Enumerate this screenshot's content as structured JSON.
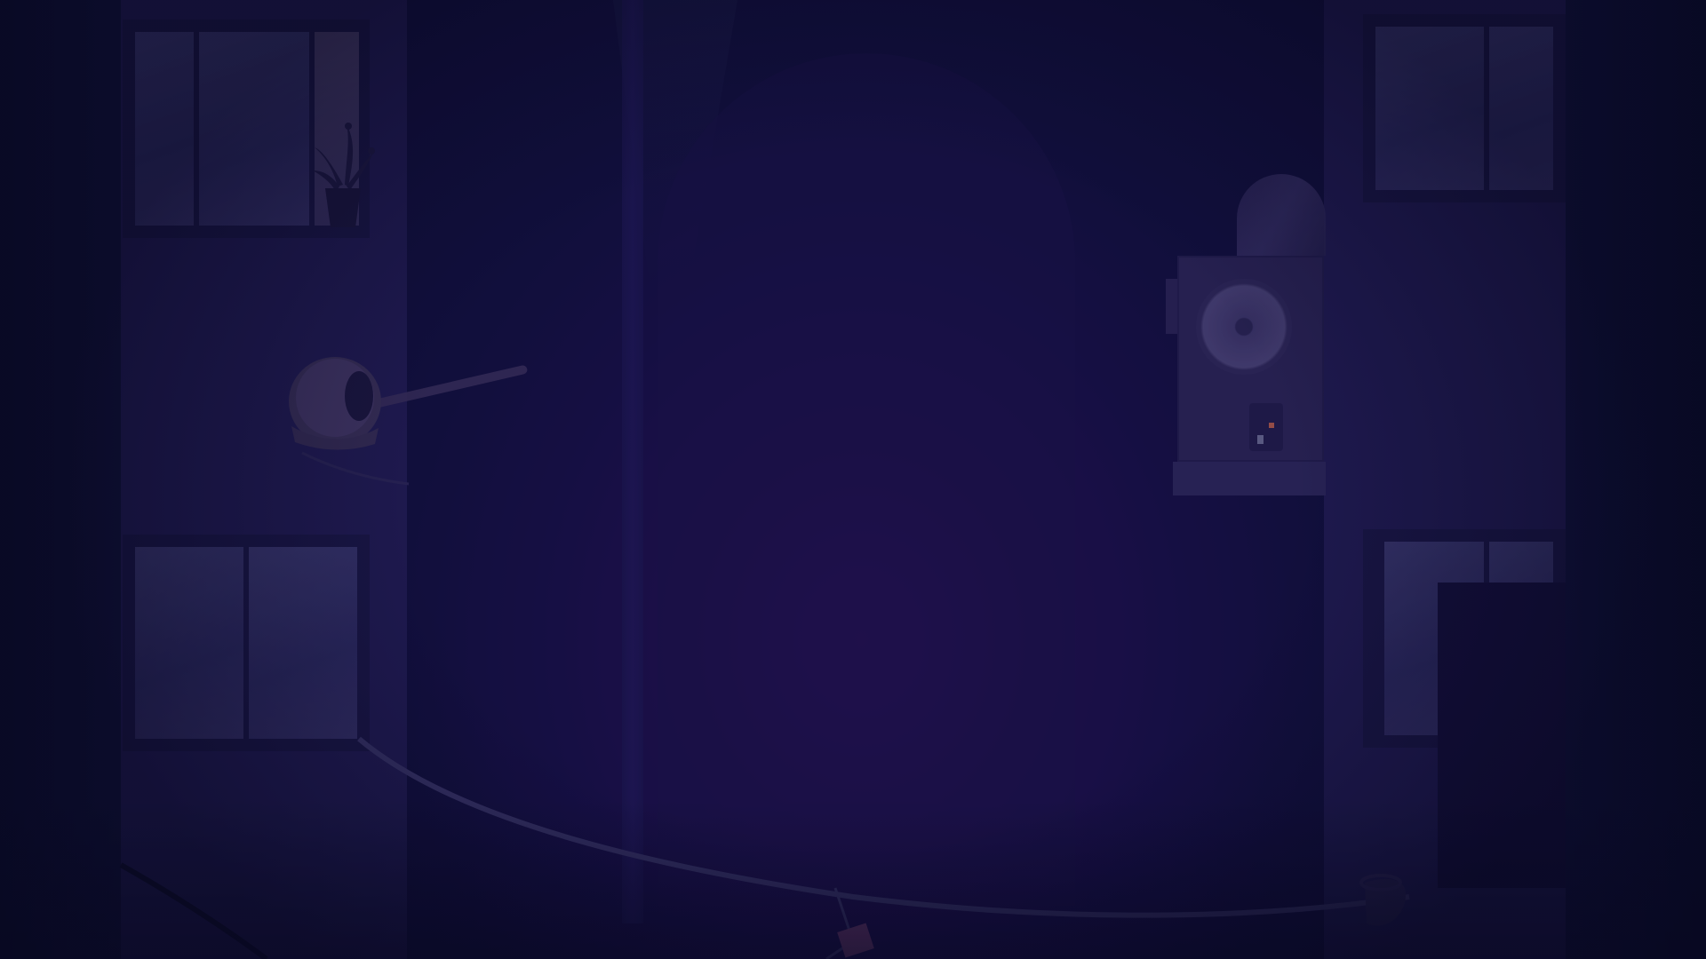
{
  "scene": {
    "description_tags": [
      "left-building",
      "right-building",
      "alley",
      "clothesline",
      "air-conditioner",
      "bird-nest",
      "potted-plant"
    ],
    "palette": {
      "background": "#170f45",
      "building": "#211c52",
      "glow": "#2a0f55",
      "window": "#3c3970"
    }
  }
}
